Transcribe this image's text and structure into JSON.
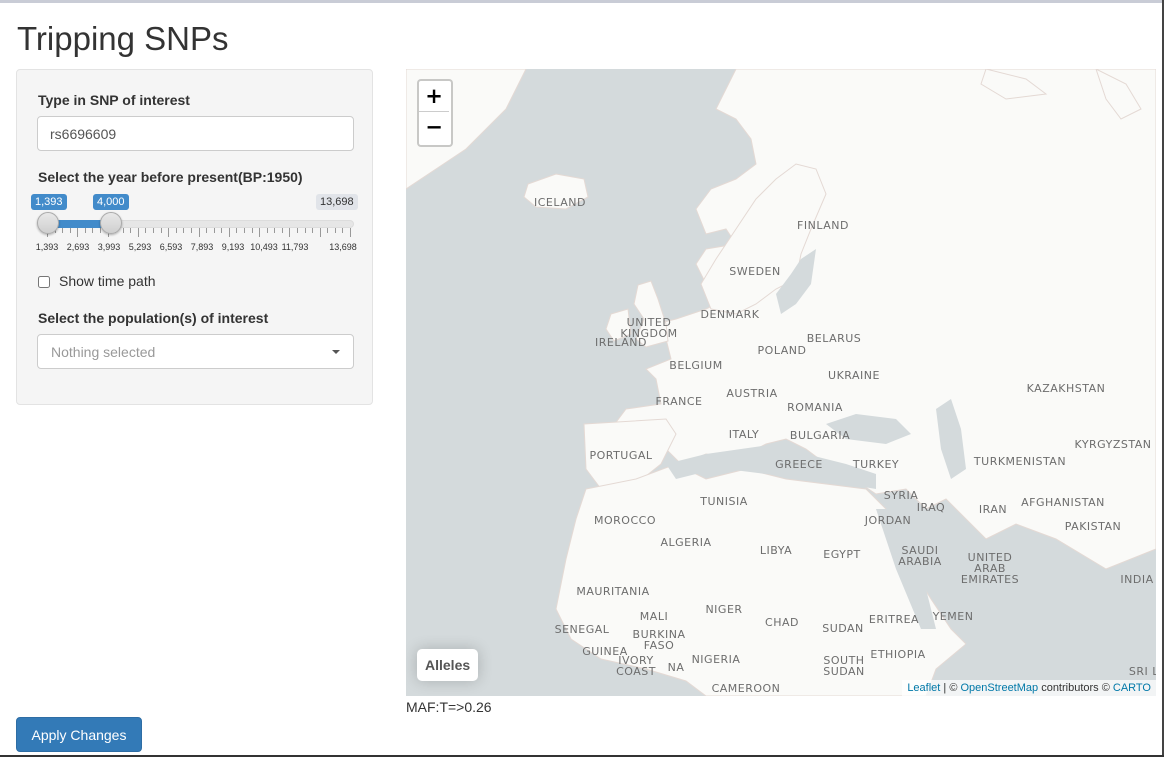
{
  "app": {
    "title": "Tripping SNPs"
  },
  "snp": {
    "label": "Type in SNP of interest",
    "value": "rs6696609"
  },
  "year": {
    "label": "Select the year before present(BP:1950)",
    "min": 1393,
    "max": 13698,
    "from": 1393,
    "to": 4000,
    "from_label": "1,393",
    "to_label": "4,000",
    "max_label": "13,698",
    "ticks": [
      "1,393",
      "2,693",
      "3,993",
      "5,293",
      "6,593",
      "7,893",
      "9,193",
      "10,493",
      "11,793",
      "13,698"
    ]
  },
  "time_path": {
    "label": "Show time path",
    "checked": false
  },
  "population": {
    "label": "Select the population(s) of interest",
    "placeholder": "Nothing selected"
  },
  "map": {
    "zoom_in": "+",
    "zoom_out": "−",
    "legend": "Alleles",
    "attribution": {
      "leaflet": "Leaflet",
      "sep1": " | © ",
      "osm": "OpenStreetMap",
      "mid": " contributors © ",
      "carto": "CARTO"
    },
    "countries": {
      "iceland": "ICELAND",
      "finland": "FINLAND",
      "sweden": "SWEDEN",
      "denmark": "DENMARK",
      "united_kingdom": "UNITED\nKINGDOM",
      "ireland": "IRELAND",
      "belarus": "BELARUS",
      "poland": "POLAND",
      "belgium": "BELGIUM",
      "ukraine": "UKRAINE",
      "kazakhstan": "KAZAKHSTAN",
      "austria": "AUSTRIA",
      "france": "FRANCE",
      "romania": "ROMANIA",
      "italy": "ITALY",
      "bulgaria": "BULGARIA",
      "kyrgyzstan": "KYRGYZSTAN",
      "portugal": "PORTUGAL",
      "greece": "GREECE",
      "turkey": "TURKEY",
      "turkmenistan": "TURKMENISTAN",
      "tunisia": "TUNISIA",
      "syria": "SYRIA",
      "afghanistan": "AFGHANISTAN",
      "iraq": "IRAQ",
      "iran": "IRAN",
      "morocco": "MOROCCO",
      "jordan": "JORDAN",
      "pakistan": "PAKISTAN",
      "algeria": "ALGERIA",
      "libya": "LIBYA",
      "egypt": "EGYPT",
      "saudi_arabia": "SAUDI\nARABIA",
      "uae": "UNITED\nARAB\nEMIRATES",
      "india": "INDIA",
      "mauritania": "MAURITANIA",
      "mali": "MALI",
      "niger": "NIGER",
      "chad": "CHAD",
      "senegal": "SENEGAL",
      "sudan": "SUDAN",
      "eritrea": "ERITREA",
      "yemen": "YEMEN",
      "burkina_faso": "BURKINA\nFASO",
      "guinea": "GUINEA",
      "ivory_coast": "IVORY\nCOAST",
      "ghana_na": "NA",
      "nigeria": "NIGERIA",
      "ethiopia": "ETHIOPIA",
      "south_sudan": "SOUTH\nSUDAN",
      "cameroon": "CAMEROON",
      "sri_lanka": "SRI LA"
    }
  },
  "maf": "MAF:T=>0.26",
  "apply": {
    "label": "Apply Changes"
  },
  "colors": {
    "primary": "#337ab7",
    "slider": "#428bca",
    "water": "#d4dadc",
    "land": "#fafaf8"
  }
}
